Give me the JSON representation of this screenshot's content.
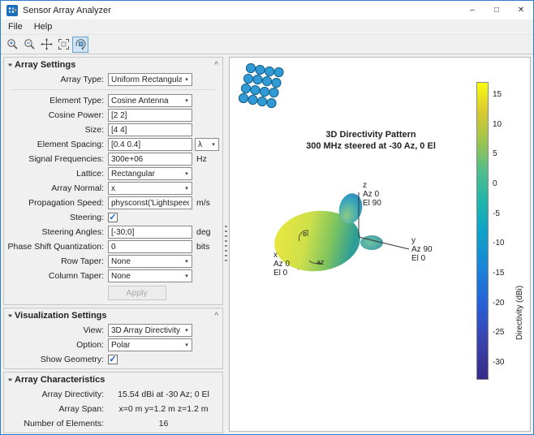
{
  "icons": {
    "collapse": "▾▾",
    "panel_toggle": "^",
    "chevron_down": "▾",
    "check": "✓",
    "minimize": "–",
    "maximize": "□",
    "close": "✕"
  },
  "window": {
    "title": "Sensor Array Analyzer"
  },
  "menu": {
    "items": [
      {
        "label": "File"
      },
      {
        "label": "Help"
      }
    ]
  },
  "panels": {
    "array_settings": {
      "title": "Array Settings",
      "rows": [
        {
          "label": "Array Type:",
          "value": "Uniform Rectangular",
          "control": "select"
        },
        {
          "label": "Element Type:",
          "value": "Cosine Antenna",
          "control": "select"
        },
        {
          "label": "Cosine Power:",
          "value": "[2 2]",
          "control": "input"
        },
        {
          "label": "Size:",
          "value": "[4 4]",
          "control": "input"
        },
        {
          "label": "Element Spacing:",
          "value": "[0.4 0.4]",
          "unit": "λ",
          "control": "input+unit-select"
        },
        {
          "label": "Signal Frequencies:",
          "value": "300e+06",
          "unit": "Hz",
          "control": "input"
        },
        {
          "label": "Lattice:",
          "value": "Rectangular",
          "control": "select"
        },
        {
          "label": "Array Normal:",
          "value": "x",
          "control": "select"
        },
        {
          "label": "Propagation Speed:",
          "value": "physconst('Lightspeed')",
          "unit": "m/s",
          "control": "input"
        },
        {
          "label": "Steering:",
          "checked": true,
          "control": "checkbox"
        },
        {
          "label": "Steering Angles:",
          "value": "[-30;0]",
          "unit": "deg",
          "control": "input"
        },
        {
          "label": "Phase Shift Quantization:",
          "value": "0",
          "unit": "bits",
          "control": "input"
        },
        {
          "label": "Row Taper:",
          "value": "None",
          "control": "select"
        },
        {
          "label": "Column Taper:",
          "value": "None",
          "control": "select"
        }
      ],
      "apply_label": "Apply"
    },
    "visualization_settings": {
      "title": "Visualization Settings",
      "rows": [
        {
          "label": "View:",
          "value": "3D Array Directivity",
          "control": "select"
        },
        {
          "label": "Option:",
          "value": "Polar",
          "control": "select"
        },
        {
          "label": "Show Geometry:",
          "checked": true,
          "control": "checkbox"
        }
      ]
    },
    "array_characteristics": {
      "title": "Array Characteristics",
      "rows": [
        {
          "label": "Array Directivity:",
          "value": "15.54 dBi at -30 Az; 0 El"
        },
        {
          "label": "Array Span:",
          "value": "x=0 m y=1.2 m z=1.2 m"
        },
        {
          "label": "Number of Elements:",
          "value": "16"
        }
      ]
    }
  },
  "plot": {
    "title_line1": "3D Directivity Pattern",
    "title_line2": "300 MHz steered at -30 Az, 0 El",
    "axes": {
      "z": [
        "z",
        "Az 0",
        "El 90"
      ],
      "y": [
        "y",
        "Az 90",
        "El 0"
      ],
      "x": [
        "x",
        "Az 0",
        "El 0"
      ],
      "el": "el",
      "az": "az"
    },
    "colorbar": {
      "label": "Directivity (dBi)",
      "ticks": [
        "15",
        "10",
        "5",
        "0",
        "-5",
        "-10",
        "-15",
        "-20",
        "-25",
        "-30"
      ]
    }
  }
}
